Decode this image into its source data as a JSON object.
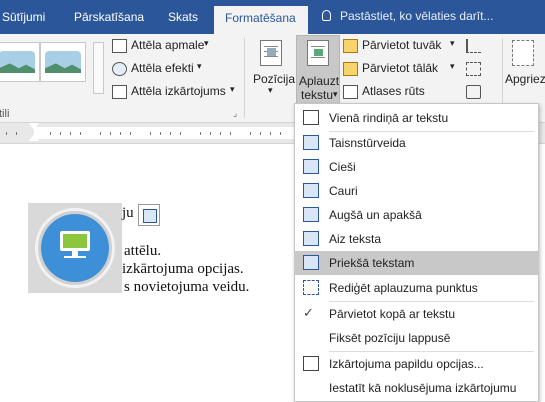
{
  "tabs": [
    {
      "label": "Sūtījumi",
      "active": false
    },
    {
      "label": "Pārskatīšana",
      "active": false
    },
    {
      "label": "Skats",
      "active": false
    },
    {
      "label": "Formatēšana",
      "active": true
    }
  ],
  "tell_me": {
    "placeholder": "Pastāstiet, ko vēlaties darīt..."
  },
  "ribbon": {
    "picture_border": "Attēla apmale",
    "picture_effects": "Attēla efekti",
    "picture_layout": "Attēla izkārtojums",
    "styles_group_partial": "tili",
    "position": "Pozīcija",
    "wrap_text_line1": "Aplauzt",
    "wrap_text_line2": "tekstu",
    "bring_forward": "Pārvietot tuvāk",
    "send_backward": "Pārvietot tālāk",
    "selection_pane": "Atlases rūts",
    "align_partial": "Apgriez"
  },
  "document": {
    "line0": "ju",
    "line1": "attēlu.",
    "line2": "izkārtojuma opcijas.",
    "line3": "s novietojuma veidu."
  },
  "wrap_menu": {
    "items": [
      {
        "label": "Vienā rindiņā ar tekstu",
        "icon": "inline-with-text-icon"
      },
      {
        "label": "Taisnstūrveida",
        "icon": "square-wrap-icon"
      },
      {
        "label": "Cieši",
        "icon": "tight-wrap-icon"
      },
      {
        "label": "Cauri",
        "icon": "through-wrap-icon"
      },
      {
        "label": "Augšā un apakšā",
        "icon": "top-bottom-wrap-icon"
      },
      {
        "label": "Aiz teksta",
        "icon": "behind-text-icon"
      },
      {
        "label": "Priekšā tekstam",
        "icon": "in-front-of-text-icon",
        "highlighted": true
      },
      {
        "label": "Rediģēt aplauzuma punktus",
        "icon": "edit-wrap-points-icon"
      },
      {
        "label": "Pārvietot kopā ar tekstu",
        "icon": "checkmark-icon",
        "checked": true
      },
      {
        "label": "Fiksēt pozīciju lappusē",
        "icon": ""
      },
      {
        "label": "Izkārtojuma papildu opcijas...",
        "icon": "layout-options-icon"
      },
      {
        "label": "Iestatīt kā noklusējuma izkārtojumu",
        "icon": ""
      }
    ]
  },
  "colors": {
    "ribbon_blue": "#2b579a",
    "picture_circle": "#3d8fd8",
    "monitor_green": "#8cc63f"
  }
}
